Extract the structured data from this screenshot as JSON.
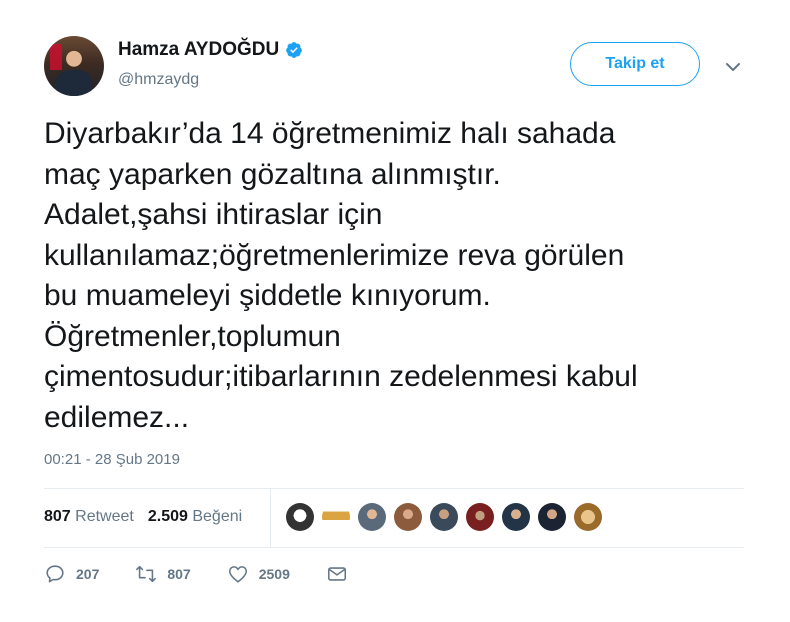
{
  "user": {
    "name": "Hamza AYDOĞDU",
    "handle": "@hmzaydg",
    "verified": true
  },
  "follow_button": {
    "label": "Takip et"
  },
  "tweet": {
    "text": "Diyarbakır’da 14 öğretmenimiz halı sahada\nmaç yaparken gözaltına alınmıştır.\nAdalet,şahsi ihtiraslar için\nkullanılamaz;öğretmenlerimize reva görülen\nbu muameleyi şiddetle kınıyorum.\nÖğretmenler,toplumun\nçimentosudur;itibarlarının zedelenmesi kabul\nedilemez...",
    "timestamp": "00:21 - 28 Şub 2019"
  },
  "stats": {
    "retweet_count": "807",
    "retweet_label": "Retweet",
    "like_count": "2.509",
    "like_label": "Beğeni"
  },
  "actions": {
    "reply_count": "207",
    "retweet_count": "807",
    "like_count": "2509"
  },
  "colors": {
    "accent": "#1da1f2",
    "text": "#14171a",
    "muted": "#657786",
    "border": "#e6ecf0"
  }
}
